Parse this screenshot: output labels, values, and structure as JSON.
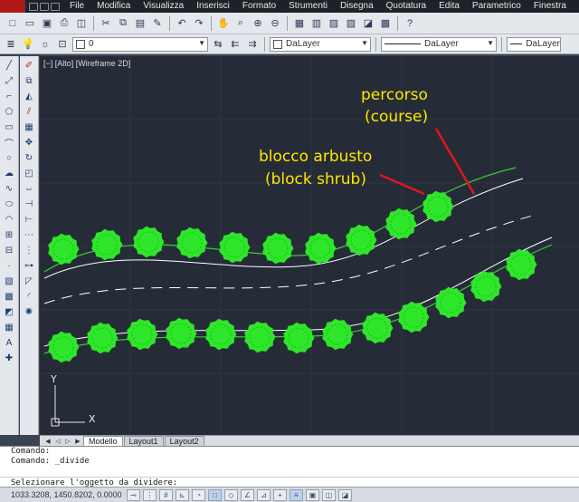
{
  "menu": {
    "items": [
      "File",
      "Modifica",
      "Visualizza",
      "Inserisci",
      "Formato",
      "Strumenti",
      "Disegna",
      "Quotatura",
      "Edita",
      "Parametrico",
      "Finestra"
    ]
  },
  "properties": {
    "layer_value": "0",
    "color_value": "DaLayer",
    "linetype_value": "DaLayer",
    "lineweight_value": "DaLayer"
  },
  "viewport": {
    "label": "[−] [Alto] [Wireframe 2D]",
    "ucs_x": "X",
    "ucs_y": "Y"
  },
  "annotations": {
    "course_line1": "percorso",
    "course_line2": "(course)",
    "shrub_line1": "blocco arbusto",
    "shrub_line2": "(block shrub)",
    "text_color": "#ffe600",
    "leader_color": "#e0161c"
  },
  "drawing": {
    "shrub_color": "#2ee62a",
    "course_color": "#3cc83c",
    "road_color": "#ffffff"
  },
  "tabs": [
    "Modello",
    "Layout1",
    "Layout2"
  ],
  "command": {
    "history": [
      "Comando:",
      "Comando: _divide"
    ],
    "prompt": "Selezionare l'oggetto da dividere:"
  },
  "status": {
    "coords": "1033.3208, 1450.8202, 0.0000"
  }
}
